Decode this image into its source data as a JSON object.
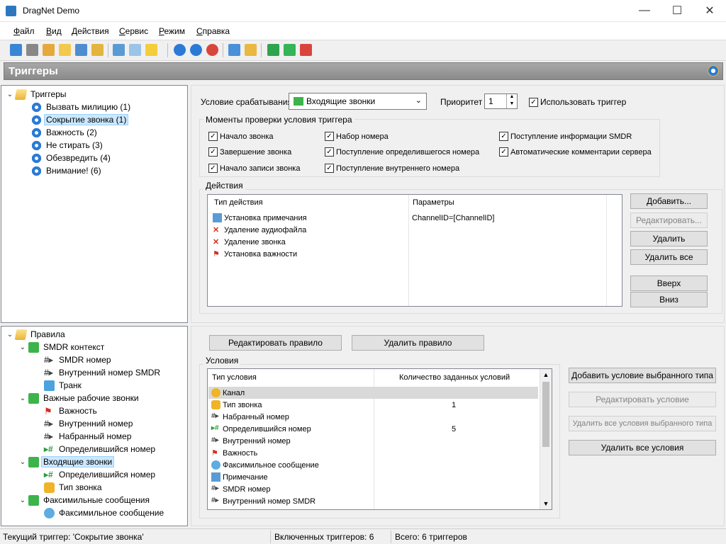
{
  "window": {
    "title": "DragNet Demo",
    "minimize": "—",
    "maximize": "☐",
    "close": "✕"
  },
  "menu": [
    "Файл",
    "Вид",
    "Действия",
    "Сервис",
    "Режим",
    "Справка"
  ],
  "header": {
    "title": "Триггеры"
  },
  "triggers_tree": {
    "root": "Триггеры",
    "items": [
      "Вызвать милицию (1)",
      "Сокрытие звонка (1)",
      "Важность (2)",
      "Не стирать (3)",
      "Обезвредить (4)",
      "Внимание! (6)"
    ],
    "selected": "Сокрытие звонка (1)"
  },
  "rules_tree": {
    "root": "Правила",
    "groups": [
      {
        "label": "SMDR контекст",
        "children": [
          "SMDR номер",
          "Внутренний номер SMDR",
          "Транк"
        ]
      },
      {
        "label": "Важные рабочие звонки",
        "children": [
          "Важность",
          "Внутренний номер",
          "Набранный номер",
          "Определившийся номер"
        ]
      },
      {
        "label": "Входящие звонки",
        "children": [
          "Определившийся номер",
          "Тип звонка"
        ]
      },
      {
        "label": "Факсимильные сообщения",
        "children": [
          "Факсимильное сообщение"
        ]
      }
    ]
  },
  "trigger_settings": {
    "condition_label": "Условие срабатывания",
    "condition_value": "Входящие звонки",
    "priority_label": "Приоритет",
    "priority_value": "1",
    "use_trigger_label": "Использовать триггер",
    "use_trigger_checked": true
  },
  "check_moments": {
    "title": "Моменты проверки условия триггера",
    "items": [
      {
        "label": "Начало звонка",
        "checked": true
      },
      {
        "label": "Завершение звонка",
        "checked": true
      },
      {
        "label": "Начало записи звонка",
        "checked": true
      },
      {
        "label": "Набор номера",
        "checked": true
      },
      {
        "label": "Поступление определившегося номера",
        "checked": true
      },
      {
        "label": "Поступление внутреннего номера",
        "checked": true
      },
      {
        "label": "Поступление информации SMDR",
        "checked": true
      },
      {
        "label": "Автоматические комментарии сервера",
        "checked": true
      }
    ]
  },
  "actions": {
    "title": "Действия",
    "columns": [
      "Тип действия",
      "Параметры"
    ],
    "rows": [
      {
        "type": "Установка примечания",
        "params": "ChannelID=[ChannelID]",
        "icon": "note-icon"
      },
      {
        "type": "Удаление аудиофайла",
        "params": "",
        "icon": "red-x-icon"
      },
      {
        "type": "Удаление звонка",
        "params": "",
        "icon": "red-x-icon"
      },
      {
        "type": "Установка важности",
        "params": "",
        "icon": "red-flag-icon"
      }
    ],
    "buttons": {
      "add": "Добавить...",
      "edit": "Редактировать...",
      "delete": "Удалить",
      "delete_all": "Удалить все",
      "up": "Вверх",
      "down": "Вниз"
    }
  },
  "rule_buttons": {
    "edit": "Редактировать правило",
    "delete": "Удалить правило"
  },
  "conditions": {
    "title": "Условия",
    "columns": [
      "Тип условия",
      "Количество заданных условий"
    ],
    "rows": [
      {
        "type": "Канал",
        "count": ""
      },
      {
        "type": "Тип звонка",
        "count": "1"
      },
      {
        "type": "Набранный номер",
        "count": ""
      },
      {
        "type": "Определившийся номер",
        "count": "5"
      },
      {
        "type": "Внутренний номер",
        "count": ""
      },
      {
        "type": "Важность",
        "count": ""
      },
      {
        "type": "Факсимильное сообщение",
        "count": ""
      },
      {
        "type": "Примечание",
        "count": ""
      },
      {
        "type": "SMDR номер",
        "count": ""
      },
      {
        "type": "Внутренний номер SMDR",
        "count": ""
      }
    ],
    "buttons": {
      "add_selected": "Добавить условие выбранного типа",
      "edit": "Редактировать условие",
      "delete_selected": "Удалить все условия выбранного типа",
      "delete_all": "Удалить все условия"
    }
  },
  "status": {
    "current": "Текущий триггер: 'Сокрытие звонка'",
    "enabled": "Включенных триггеров: 6",
    "total": "Всего: 6 триггеров"
  }
}
